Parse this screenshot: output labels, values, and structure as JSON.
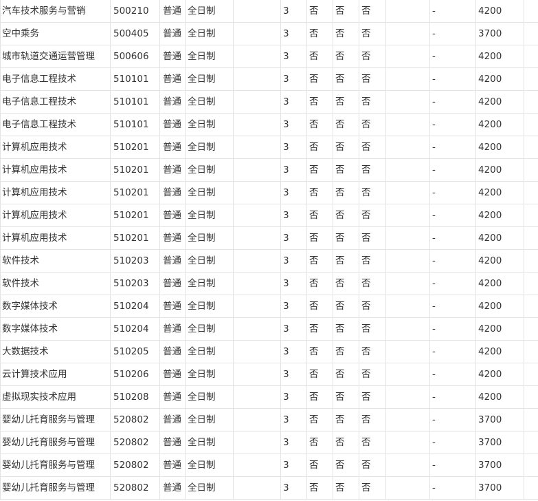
{
  "table": {
    "rows": [
      [
        "汽车技术服务与营销",
        "500210",
        "普通",
        "全日制",
        "",
        "3",
        "否",
        "否",
        "否",
        "",
        "-",
        "4200",
        ""
      ],
      [
        "空中乘务",
        "500405",
        "普通",
        "全日制",
        "",
        "3",
        "否",
        "否",
        "否",
        "",
        "-",
        "3700",
        ""
      ],
      [
        "城市轨道交通运营管理",
        "500606",
        "普通",
        "全日制",
        "",
        "3",
        "否",
        "否",
        "否",
        "",
        "-",
        "4200",
        ""
      ],
      [
        "电子信息工程技术",
        "510101",
        "普通",
        "全日制",
        "",
        "3",
        "否",
        "否",
        "否",
        "",
        "-",
        "4200",
        ""
      ],
      [
        "电子信息工程技术",
        "510101",
        "普通",
        "全日制",
        "",
        "3",
        "否",
        "否",
        "否",
        "",
        "-",
        "4200",
        ""
      ],
      [
        "电子信息工程技术",
        "510101",
        "普通",
        "全日制",
        "",
        "3",
        "否",
        "否",
        "否",
        "",
        "-",
        "4200",
        ""
      ],
      [
        "计算机应用技术",
        "510201",
        "普通",
        "全日制",
        "",
        "3",
        "否",
        "否",
        "否",
        "",
        "-",
        "4200",
        ""
      ],
      [
        "计算机应用技术",
        "510201",
        "普通",
        "全日制",
        "",
        "3",
        "否",
        "否",
        "否",
        "",
        "-",
        "4200",
        ""
      ],
      [
        "计算机应用技术",
        "510201",
        "普通",
        "全日制",
        "",
        "3",
        "否",
        "否",
        "否",
        "",
        "-",
        "4200",
        ""
      ],
      [
        "计算机应用技术",
        "510201",
        "普通",
        "全日制",
        "",
        "3",
        "否",
        "否",
        "否",
        "",
        "-",
        "4200",
        ""
      ],
      [
        "计算机应用技术",
        "510201",
        "普通",
        "全日制",
        "",
        "3",
        "否",
        "否",
        "否",
        "",
        "-",
        "4200",
        ""
      ],
      [
        "软件技术",
        "510203",
        "普通",
        "全日制",
        "",
        "3",
        "否",
        "否",
        "否",
        "",
        "-",
        "4200",
        ""
      ],
      [
        "软件技术",
        "510203",
        "普通",
        "全日制",
        "",
        "3",
        "否",
        "否",
        "否",
        "",
        "-",
        "4200",
        ""
      ],
      [
        "数字媒体技术",
        "510204",
        "普通",
        "全日制",
        "",
        "3",
        "否",
        "否",
        "否",
        "",
        "-",
        "4200",
        ""
      ],
      [
        "数字媒体技术",
        "510204",
        "普通",
        "全日制",
        "",
        "3",
        "否",
        "否",
        "否",
        "",
        "-",
        "4200",
        ""
      ],
      [
        "大数据技术",
        "510205",
        "普通",
        "全日制",
        "",
        "3",
        "否",
        "否",
        "否",
        "",
        "-",
        "4200",
        ""
      ],
      [
        "云计算技术应用",
        "510206",
        "普通",
        "全日制",
        "",
        "3",
        "否",
        "否",
        "否",
        "",
        "-",
        "4200",
        ""
      ],
      [
        "虚拟现实技术应用",
        "510208",
        "普通",
        "全日制",
        "",
        "3",
        "否",
        "否",
        "否",
        "",
        "-",
        "4200",
        ""
      ],
      [
        "婴幼儿托育服务与管理",
        "520802",
        "普通",
        "全日制",
        "",
        "3",
        "否",
        "否",
        "否",
        "",
        "-",
        "3700",
        ""
      ],
      [
        "婴幼儿托育服务与管理",
        "520802",
        "普通",
        "全日制",
        "",
        "3",
        "否",
        "否",
        "否",
        "",
        "-",
        "3700",
        ""
      ],
      [
        "婴幼儿托育服务与管理",
        "520802",
        "普通",
        "全日制",
        "",
        "3",
        "否",
        "否",
        "否",
        "",
        "-",
        "3700",
        ""
      ],
      [
        "婴幼儿托育服务与管理",
        "520802",
        "普通",
        "全日制",
        "",
        "3",
        "否",
        "否",
        "否",
        "",
        "-",
        "3700",
        ""
      ]
    ]
  }
}
